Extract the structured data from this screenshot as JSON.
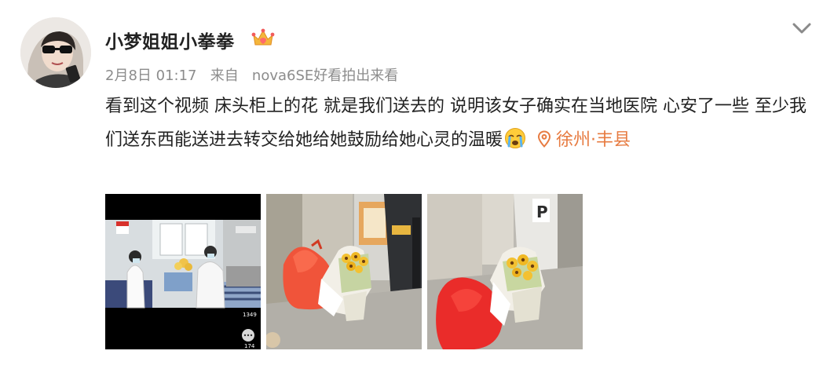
{
  "user": {
    "name": "小梦姐姐小拳拳",
    "badge_icon": "crown-badge-icon"
  },
  "post": {
    "date": "2月8日 01:17",
    "source_prefix": "来自",
    "source": "nova6SE好看拍出来看",
    "text": "看到这个视频 床头柜上的花 就是我们送去的 说明该女子确实在当地医院 心安了一些 至少我们送东西能送进去转交给她给她鼓励给她心灵的温暖",
    "location": "徐州·丰县",
    "location_color": "#e77b41"
  },
  "images": [
    {
      "name": "video-thumbnail",
      "overlay_top": "1349",
      "overlay_bottom": "174"
    },
    {
      "name": "photo-gift-bag-sunflowers-1"
    },
    {
      "name": "photo-gift-bag-sunflowers-2"
    }
  ],
  "icons": {
    "expand": "chevron-down-icon",
    "location": "location-pin-icon",
    "emoji": "crying-emoji-icon"
  }
}
